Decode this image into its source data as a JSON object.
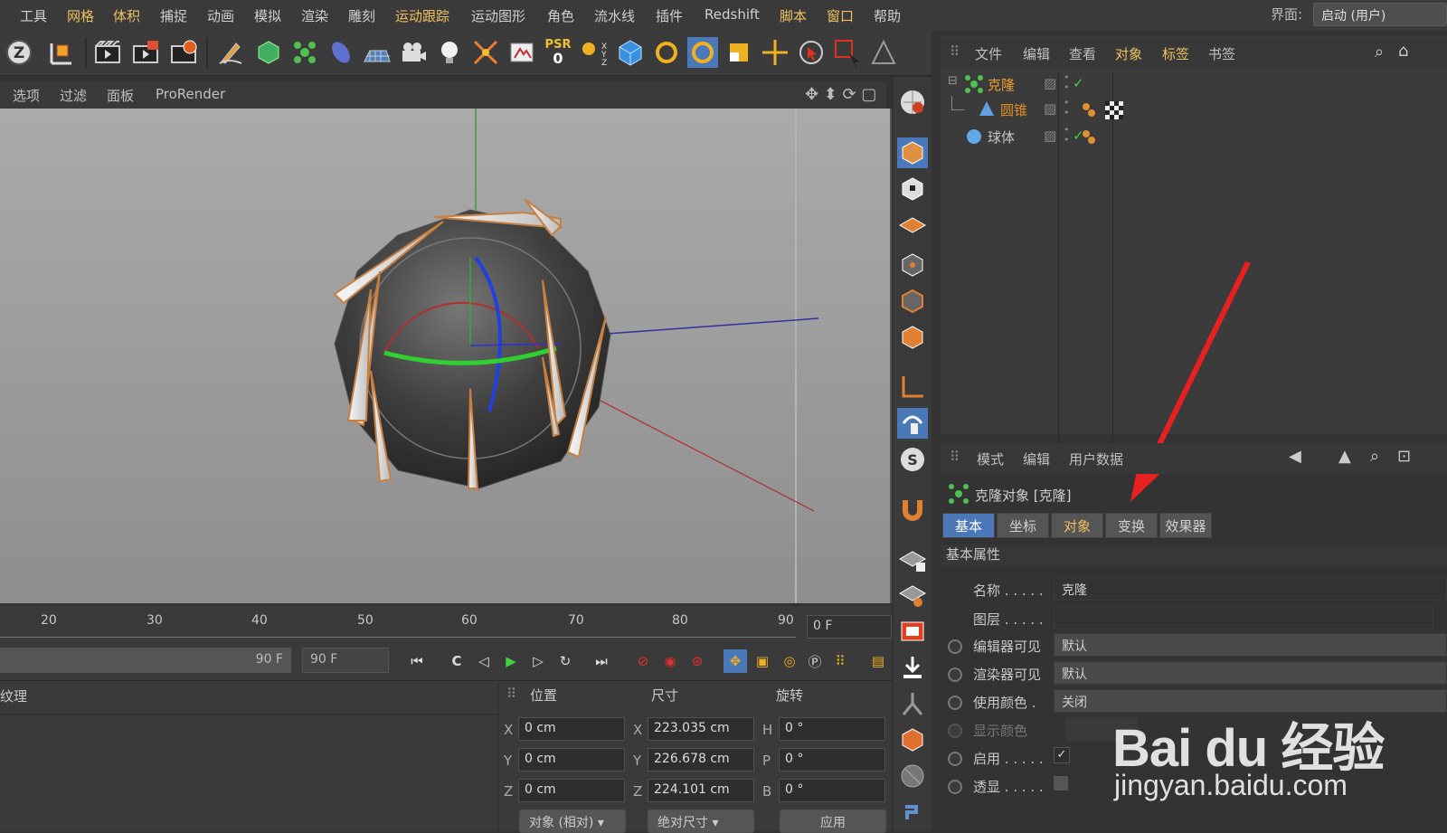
{
  "menubar": {
    "items": [
      "工具",
      "网格",
      "体积",
      "捕捉",
      "动画",
      "模拟",
      "渲染",
      "雕刻",
      "运动跟踪",
      "运动图形",
      "角色",
      "流水线",
      "插件",
      "Redshift",
      "脚本",
      "窗口",
      "帮助"
    ],
    "interface_label": "界面:",
    "interface_value": "启动 (用户)"
  },
  "toolbar": {
    "icons": [
      "axis-z-icon",
      "coordinate-system-icon",
      "render-view-icon",
      "render-picture-queue-icon",
      "render-settings-icon",
      "pen-icon",
      "cube-generator-icon",
      "cloner-icon",
      "deformer-icon",
      "floor-icon",
      "camera-icon",
      "light-icon",
      "effector-icon",
      "tag-icon",
      "psr-icon",
      "xyz-icon",
      "view-cube-icon",
      "rotate-icon",
      "rotate-active-icon",
      "scale-icon",
      "move-icon",
      "select-icon",
      "rect-select-icon",
      "live-select-icon"
    ],
    "psr_label": "PSR",
    "psr_value": "0"
  },
  "viewport_menu": {
    "items": [
      "选项",
      "过滤",
      "面板",
      "ProRender"
    ]
  },
  "object_manager": {
    "menu": [
      "文件",
      "编辑",
      "查看",
      "对象",
      "标签",
      "书签"
    ],
    "objects": [
      {
        "name": "克隆",
        "icon": "cloner-icon",
        "color": "#f0a030"
      },
      {
        "name": "圆锥",
        "icon": "cone-icon",
        "color": "#e09020"
      },
      {
        "name": "球体",
        "icon": "sphere-icon",
        "color": "#c8c8c8"
      }
    ]
  },
  "attribute_manager": {
    "menu": [
      "模式",
      "编辑",
      "用户数据"
    ],
    "title": "克隆对象 [克隆]",
    "tabs": [
      "基本",
      "坐标",
      "对象",
      "变换",
      "效果器"
    ],
    "active_tab": "基本",
    "section": "基本属性",
    "props": [
      {
        "label": "名称",
        "value": "克隆"
      },
      {
        "label": "图层",
        "value": ""
      },
      {
        "label": "编辑器可见",
        "value": "默认"
      },
      {
        "label": "渲染器可见",
        "value": "默认"
      },
      {
        "label": "使用颜色",
        "value": "关闭"
      },
      {
        "label": "显示颜色",
        "value": ""
      },
      {
        "label": "启用",
        "value": "✓"
      },
      {
        "label": "透显",
        "value": ""
      }
    ]
  },
  "timeline": {
    "ticks": [
      "20",
      "30",
      "40",
      "50",
      "60",
      "70",
      "80",
      "90"
    ],
    "current_frame": "0 F",
    "end_frame_bar": "90 F",
    "end_frame": "90 F"
  },
  "material_panel": {
    "title": "纹理"
  },
  "coordinates": {
    "headers": [
      "位置",
      "尺寸",
      "旋转"
    ],
    "rows": [
      {
        "axis": "X",
        "pos": "0 cm",
        "size_axis": "X",
        "size": "223.035 cm",
        "rot_axis": "H",
        "rot": "0 °"
      },
      {
        "axis": "Y",
        "pos": "0 cm",
        "size_axis": "Y",
        "size": "226.678 cm",
        "rot_axis": "P",
        "rot": "0 °"
      },
      {
        "axis": "Z",
        "pos": "0 cm",
        "size_axis": "Z",
        "size": "224.101 cm",
        "rot_axis": "B",
        "rot": "0 °"
      }
    ],
    "mode": "对象 (相对)",
    "size_mode": "绝对尺寸",
    "apply_label": "应用"
  },
  "watermark": {
    "brand": "Bai du 经验",
    "url": "jingyan.baidu.com"
  },
  "colors": {
    "accent": "#4a78b8",
    "highlight": "#f0c060",
    "arrow": "#e82020"
  }
}
